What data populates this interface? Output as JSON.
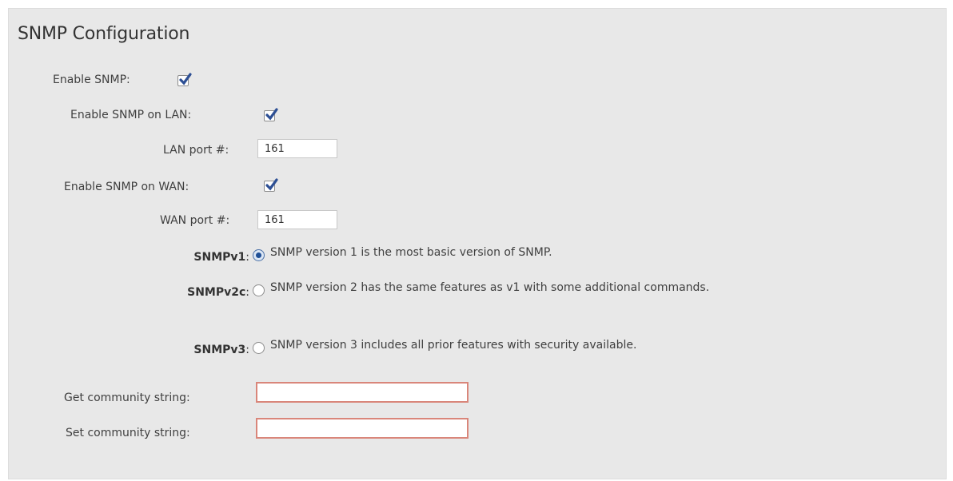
{
  "title": "SNMP Configuration",
  "enable_snmp": {
    "label": "Enable SNMP:",
    "checked": true
  },
  "enable_lan": {
    "label": "Enable SNMP on LAN:",
    "checked": true
  },
  "lan_port": {
    "label": "LAN port #:",
    "value": "161"
  },
  "enable_wan": {
    "label": "Enable SNMP on WAN:",
    "checked": true
  },
  "wan_port": {
    "label": "WAN port #:",
    "value": "161"
  },
  "versions": [
    {
      "name": "SNMPv1",
      "sep": ":",
      "selected": true,
      "desc": "SNMP version 1 is the most basic version of SNMP."
    },
    {
      "name": "SNMPv2c",
      "sep": ":",
      "selected": false,
      "desc": "SNMP version 2 has the same features as v1 with some additional commands."
    },
    {
      "name": "SNMPv3",
      "sep": ":",
      "selected": false,
      "desc": "SNMP version 3 includes all prior features with security available."
    }
  ],
  "get_community": {
    "label": "Get community string:",
    "value": ""
  },
  "set_community": {
    "label": "Set community string:",
    "value": ""
  },
  "colors": {
    "checkmark": "#2d4f94",
    "required_border": "#d9867a",
    "panel_bg": "#e8e8e8"
  }
}
